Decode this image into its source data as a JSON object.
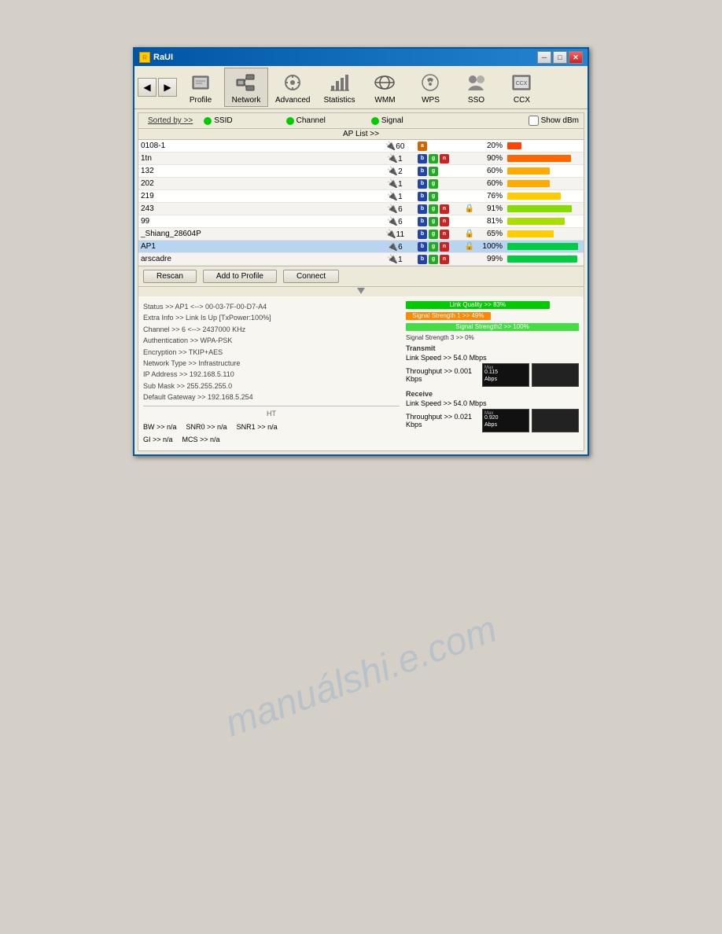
{
  "window": {
    "title": "RaUI",
    "close_btn": "✕",
    "min_btn": "─",
    "max_btn": "□"
  },
  "toolbar": {
    "nav_back": "◀",
    "nav_fwd": "▶",
    "items": [
      {
        "id": "profile",
        "label": "Profile",
        "icon": "👤",
        "active": false
      },
      {
        "id": "network",
        "label": "Network",
        "icon": "🖥",
        "active": true
      },
      {
        "id": "advanced",
        "label": "Advanced",
        "icon": "⚙",
        "active": false
      },
      {
        "id": "statistics",
        "label": "Statistics",
        "icon": "📊",
        "active": false
      },
      {
        "id": "wmm",
        "label": "WMM",
        "icon": "📡",
        "active": false
      },
      {
        "id": "wps",
        "label": "WPS",
        "icon": "🔑",
        "active": false
      },
      {
        "id": "sso",
        "label": "SSO",
        "icon": "👥",
        "active": false
      },
      {
        "id": "ccx",
        "label": "CCX",
        "icon": "📋",
        "active": false
      }
    ]
  },
  "ap_list": {
    "sorted_by": "Sorted by >>",
    "ssid_label": "SSID",
    "channel_label": "Channel",
    "signal_label": "Signal",
    "show_dbm": "Show dBm",
    "ap_list_label": "AP List >>",
    "entries": [
      {
        "ssid": "0108-1",
        "channel": "60",
        "badges": [
          "a"
        ],
        "lock": false,
        "signal_pct": 20,
        "bar_color": "#ff4400",
        "selected": false
      },
      {
        "ssid": "1tn",
        "channel": "1",
        "badges": [
          "b",
          "g",
          "n"
        ],
        "lock": false,
        "signal_pct": 90,
        "bar_color": "#ff6600",
        "selected": false
      },
      {
        "ssid": "132",
        "channel": "2",
        "badges": [
          "b",
          "g"
        ],
        "lock": false,
        "signal_pct": 60,
        "bar_color": "#ffaa00",
        "selected": false
      },
      {
        "ssid": "202",
        "channel": "1",
        "badges": [
          "b",
          "g"
        ],
        "lock": false,
        "signal_pct": 60,
        "bar_color": "#ffaa00",
        "selected": false
      },
      {
        "ssid": "219",
        "channel": "1",
        "badges": [
          "b",
          "g"
        ],
        "lock": false,
        "signal_pct": 76,
        "bar_color": "#ffcc00",
        "selected": false
      },
      {
        "ssid": "243",
        "channel": "6",
        "badges": [
          "b",
          "g",
          "n"
        ],
        "lock": true,
        "signal_pct": 91,
        "bar_color": "#88dd00",
        "selected": false
      },
      {
        "ssid": "99",
        "channel": "6",
        "badges": [
          "b",
          "g",
          "n"
        ],
        "lock": false,
        "signal_pct": 81,
        "bar_color": "#aadd00",
        "selected": false
      },
      {
        "ssid": "_Shiang_28604P",
        "channel": "11",
        "badges": [
          "b",
          "g",
          "n"
        ],
        "lock": true,
        "signal_pct": 65,
        "bar_color": "#ffcc00",
        "selected": false
      },
      {
        "ssid": "AP1",
        "channel": "6",
        "badges": [
          "b",
          "g",
          "n"
        ],
        "lock": true,
        "signal_pct": 100,
        "bar_color": "#00cc44",
        "selected": true
      },
      {
        "ssid": "arscadre",
        "channel": "1",
        "badges": [
          "b",
          "g",
          "n"
        ],
        "lock": false,
        "signal_pct": 99,
        "bar_color": "#00cc44",
        "selected": false
      }
    ],
    "buttons": {
      "rescan": "Rescan",
      "add_to_profile": "Add to Profile",
      "connect": "Connect"
    }
  },
  "details": {
    "status": "Status >> AP1 <--> 00-03-7F-00-D7-A4",
    "extra_info": "Extra Info >> Link Is Up [TxPower:100%]",
    "channel": "Channel >> 6 <--> 2437000 KHz",
    "authentication": "Authentication >> WPA-PSK",
    "encryption": "Encryption >> TKIP+AES",
    "network_type": "Network Type >> Infrastructure",
    "ip_address": "IP Address >> 192.168.5.110",
    "subnet_mask": "Sub Mask >> 255.255.255.0",
    "default_gateway": "Default Gateway >> 192.168.5.254",
    "ht_divider": "HT",
    "bw": "BW >> n/a",
    "gi": "GI >> n/a",
    "snr0": "SNR0 >> n/a",
    "mcs": "MCS >> n/a",
    "snr1": "SNR1 >> n/a"
  },
  "signal_meters": {
    "link_quality": {
      "label": "Link Quality >> 83%",
      "pct": 83,
      "color": "#00aa44"
    },
    "signal_strength1": {
      "label": "Signal Strength 1 >> 49%",
      "pct": 49,
      "color": "#ff8800"
    },
    "signal_strength2": {
      "label": "Signal Strength2 >> 100%",
      "pct": 100,
      "color": "#44cc44"
    },
    "signal_strength3": {
      "label": "Signal Strength 3 >> 0%",
      "pct": 0,
      "color": "#cccccc"
    }
  },
  "transmit": {
    "label": "Transmit",
    "link_speed": "Link Speed >> 54.0 Mbps",
    "throughput": "Throughput >> 0.001 Kbps",
    "chart_value": "0.115",
    "chart_unit": "Abps",
    "max_label": "Max"
  },
  "receive": {
    "label": "Receive",
    "link_speed": "Link Speed >> 54.0 Mbps",
    "throughput": "Throughput >> 0.021 Kbps",
    "chart_value": "0.920",
    "chart_unit": "Abps",
    "max_label": "Max"
  },
  "watermark": "manuálshi.e.com"
}
